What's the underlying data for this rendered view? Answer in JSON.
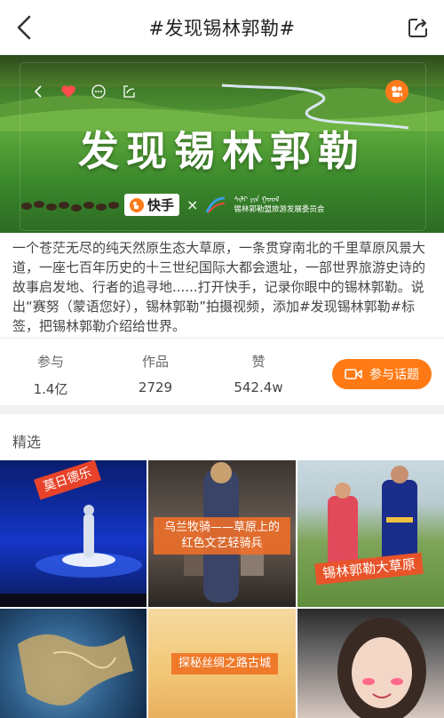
{
  "header": {
    "title": "#发现锡林郭勒#",
    "back_icon": "chevron-left-icon",
    "share_icon": "share-out-icon"
  },
  "banner": {
    "title": "发现锡林郭勒",
    "brand": "快手",
    "cross": "×",
    "org_name": "锡林郭勒盟旅游发展委员会"
  },
  "description": "一个苍茫无尽的纯天然原生态大草原，一条贯穿南北的千里草原风景大道，一座七百年历史的十三世纪国际大都会遗址，一部世界旅游史诗的故事启发地、行者的追寻地......打开快手，记录你眼中的锡林郭勒。说出“赛努（蒙语您好），锡林郭勒”拍摄视频，添加#发现锡林郭勒#标签，把锡林郭勒介绍给世界。",
  "stats": [
    {
      "label": "参与",
      "value": "1.4亿"
    },
    {
      "label": "作品",
      "value": "2729"
    },
    {
      "label": "赞",
      "value": "542.4w"
    }
  ],
  "join_button": "参与话题",
  "section_title": "精选",
  "tiles": [
    {
      "tag": "莫日德乐"
    },
    {
      "tag": "乌兰牧骑——草原上的红色文艺轻骑兵"
    },
    {
      "tag": "锡林郭勒大草原"
    },
    {
      "tag": ""
    },
    {
      "tag": "探秘丝绸之路古城"
    },
    {
      "tag": ""
    }
  ],
  "colors": {
    "accent": "#ff7a14",
    "grass": "#4a9a34"
  }
}
